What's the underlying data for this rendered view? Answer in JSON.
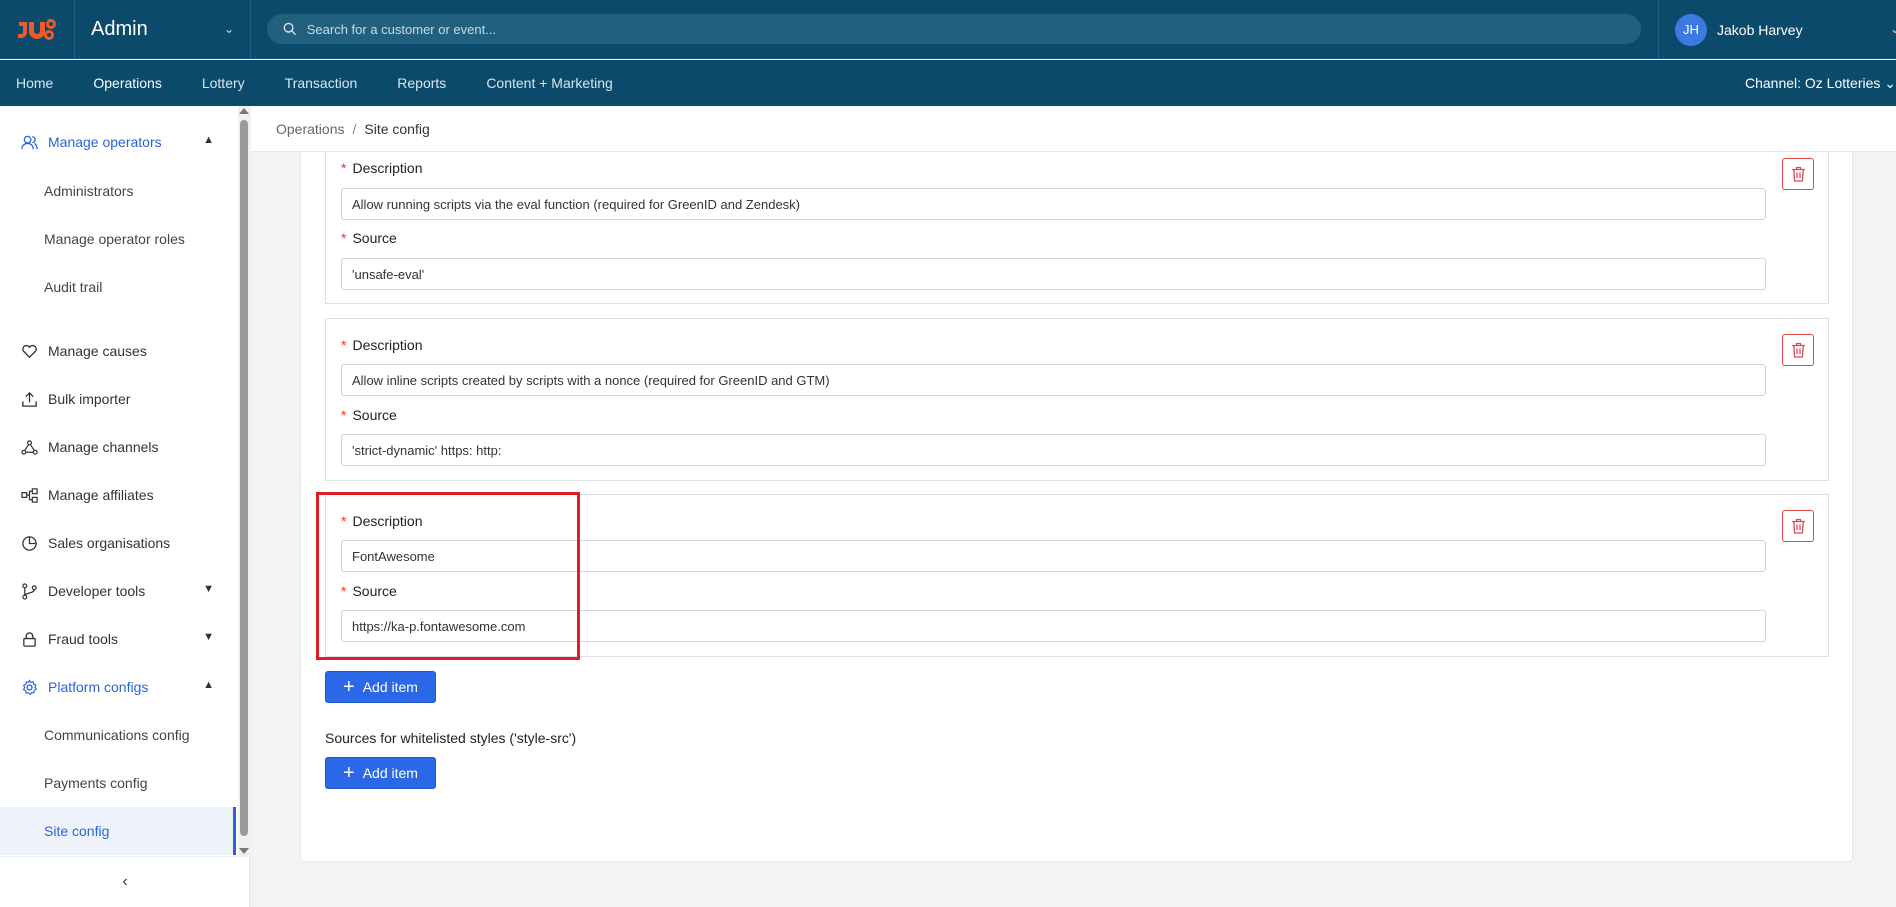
{
  "header": {
    "app_title": "Admin",
    "search_placeholder": "Search for a customer or event...",
    "user_initials": "JH",
    "user_name": "Jakob Harvey"
  },
  "nav": {
    "items": [
      "Home",
      "Operations",
      "Lottery",
      "Transaction",
      "Reports",
      "Content + Marketing"
    ],
    "active": "Operations",
    "channel": "Channel: Oz Lotteries"
  },
  "sidebar": {
    "manage_operators": "Manage operators",
    "administrators": "Administrators",
    "manage_operator_roles": "Manage operator roles",
    "audit_trail": "Audit trail",
    "manage_causes": "Manage causes",
    "bulk_importer": "Bulk importer",
    "manage_channels": "Manage channels",
    "manage_affiliates": "Manage affiliates",
    "sales_organisations": "Sales organisations",
    "developer_tools": "Developer tools",
    "fraud_tools": "Fraud tools",
    "platform_configs": "Platform configs",
    "communications_config": "Communications config",
    "payments_config": "Payments config",
    "site_config": "Site config"
  },
  "breadcrumb": {
    "parent": "Operations",
    "separator": "/",
    "current": "Site config"
  },
  "form": {
    "description_label": "Description",
    "source_label": "Source",
    "items": [
      {
        "description": "Allow running scripts via the eval function (required for GreenID and Zendesk)",
        "source": "'unsafe-eval'"
      },
      {
        "description": "Allow inline scripts created by scripts with a nonce (required for GreenID and GTM)",
        "source": "'strict-dynamic' https: http:"
      },
      {
        "description": "FontAwesome",
        "source": "https://ka-p.fontawesome.com"
      }
    ],
    "add_item_label": "Add item",
    "style_section_label": "Sources for whitelisted styles ('style-src')"
  },
  "colors": {
    "header_bg": "#0b4a6b",
    "accent_blue": "#2a68e8",
    "delete_red": "#e04848",
    "highlight_red": "#e01e28"
  }
}
